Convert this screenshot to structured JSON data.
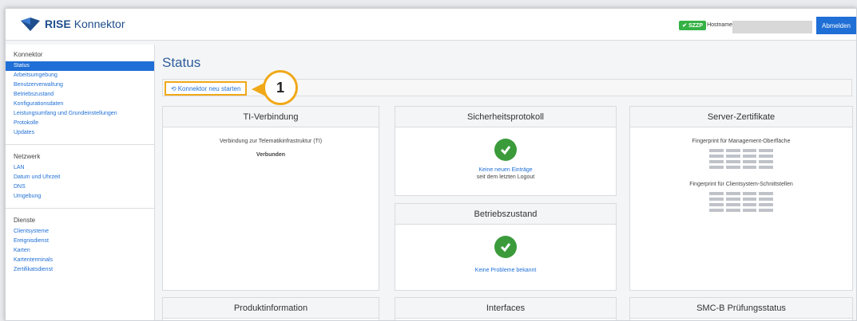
{
  "header": {
    "brand": "RISE",
    "brand_suffix": "Konnektor",
    "tz_badge": "✔ SZZP",
    "hostname_label": "Hostname",
    "logout_label": "Abmelden"
  },
  "sidebar": {
    "sections": [
      {
        "title": "Konnektor",
        "items": [
          "Status",
          "Arbeitsumgebung",
          "Benutzerverwaltung",
          "Betriebszustand",
          "Konfigurationsdaten",
          "Leistungsumfang und Grundeinstellungen",
          "Protokolle",
          "Updates"
        ]
      },
      {
        "title": "Netzwerk",
        "items": [
          "LAN",
          "Datum und Uhrzeit",
          "DNS",
          "Umgebung"
        ]
      },
      {
        "title": "Dienste",
        "items": [
          "Clientsysteme",
          "Ereignisdienst",
          "Karten",
          "Kartenterminals",
          "Zertifikatsdienst"
        ]
      }
    ]
  },
  "main": {
    "title": "Status",
    "restart_label": "Konnektor neu starten",
    "callout_number": "1",
    "ti": {
      "title": "TI-Verbindung",
      "desc": "Verbindung zur Telematikinfrastruktur (TI)",
      "status": "Verbunden"
    },
    "security": {
      "title": "Sicherheitsprotokoll",
      "link": "Keine neuen Einträge",
      "sub": "seit dem letzten Logout"
    },
    "operation": {
      "title": "Betriebszustand",
      "link": "Keine Probleme bekannt"
    },
    "certs": {
      "title": "Server-Zertifikate",
      "fp1": "Fingerprint für Management-Oberfläche",
      "fp2": "Fingerprint für Clientsystem-Schnittstellen"
    },
    "product": {
      "title": "Produktinformation"
    },
    "interfaces": {
      "title": "Interfaces"
    },
    "smcb": {
      "title": "SMC-B Prüfungsstatus"
    }
  }
}
